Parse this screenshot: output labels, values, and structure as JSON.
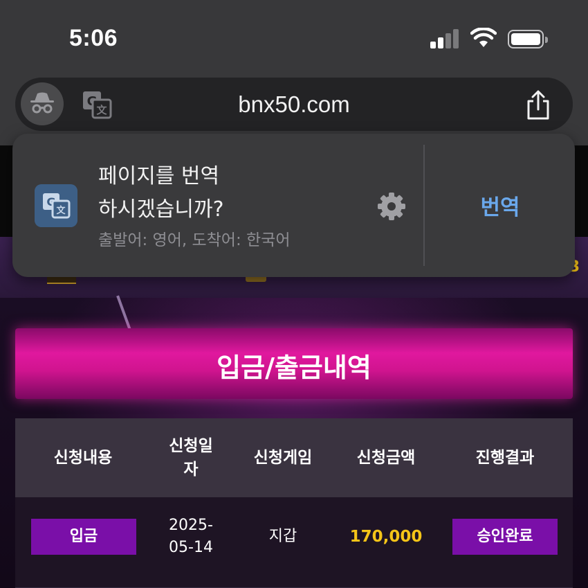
{
  "status_bar": {
    "time": "5:06",
    "icons": [
      "cellular-signal-icon",
      "wifi-icon",
      "battery-icon"
    ]
  },
  "address_bar": {
    "url": "bnx50.com",
    "icons": [
      "incognito-icon",
      "translate-icon",
      "share-icon"
    ]
  },
  "translate_popup": {
    "prompt": "페이지를 번역\n하시겠습니까?",
    "languages": "출발어: 영어, 도착어: 한국어",
    "translate_button": "번역",
    "icons": [
      "google-translate-icon",
      "gear-icon"
    ]
  },
  "page": {
    "banner_title": "입금/출금내역",
    "partial_number": "3",
    "table": {
      "columns": [
        "신청내용",
        "신청일\n자",
        "신청게임",
        "신청금액",
        "진행결과"
      ],
      "rows": [
        {
          "type": "입금",
          "date": "2025-\n05-14",
          "game": "지갑",
          "amount": "170,000",
          "result": "승인완료"
        }
      ]
    }
  },
  "colors": {
    "accent_magenta": "#e0189e",
    "badge_purple": "#7a0fa8",
    "amount_gold": "#f5c518",
    "translate_blue": "#6aa8ec"
  }
}
